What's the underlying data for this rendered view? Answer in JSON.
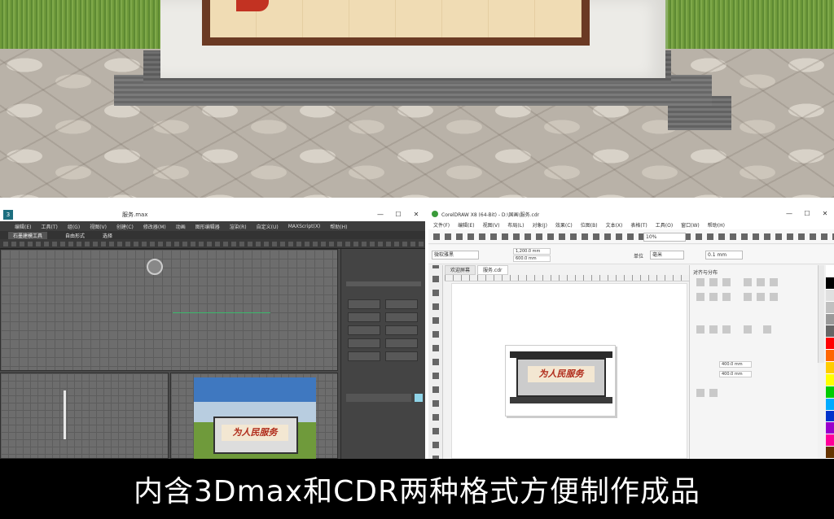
{
  "max_window": {
    "logo": "3",
    "title": "服务.max",
    "window_controls": [
      "—",
      "☐",
      "✕"
    ],
    "menu": [
      "编辑(E)",
      "工具(T)",
      "组(G)",
      "视图(V)",
      "创建(C)",
      "修改器(M)",
      "动画",
      "图形编辑器",
      "渲染(R)",
      "自定义(U)",
      "MAXScript(X)",
      "帮助(H)"
    ],
    "ribbon_tabs": [
      "石墨建模工具",
      "自由形式",
      "选择"
    ],
    "render_thumb_text": "为人民服务"
  },
  "cdr_window": {
    "title": "CorelDRAW X8 (64-Bit) - D:\\国画\\服务.cdr",
    "window_controls": [
      "—",
      "☐",
      "✕"
    ],
    "menu": [
      "文件(F)",
      "编辑(E)",
      "视图(V)",
      "布局(L)",
      "对象(J)",
      "效果(C)",
      "位图(B)",
      "文本(X)",
      "表格(T)",
      "工具(O)",
      "窗口(W)",
      "帮助(H)"
    ],
    "font_box": "微软雅黑",
    "zoom": "10%",
    "unit_label": "单位",
    "unit_value": "毫米",
    "nudge": "0.1 mm",
    "size_w": "1,200.0 mm",
    "size_h": "600.0 mm",
    "tabs": [
      "欢迎屏幕",
      "服务.cdr"
    ],
    "sign_text": "为人民服务",
    "docker_title": "对齐与分布",
    "docker_field_1": "400.0 mm",
    "docker_field_2": "400.0 mm",
    "palette": [
      "#ffffff",
      "#000000",
      "#e0e0e0",
      "#c0c0c0",
      "#999999",
      "#666666",
      "#ff0000",
      "#ff6600",
      "#ffcc00",
      "#ffff00",
      "#00cc00",
      "#00aaff",
      "#0033cc",
      "#9900cc",
      "#ff0099",
      "#663300"
    ]
  },
  "caption": "内含3Dmax和CDR两种格式方便制作成品"
}
